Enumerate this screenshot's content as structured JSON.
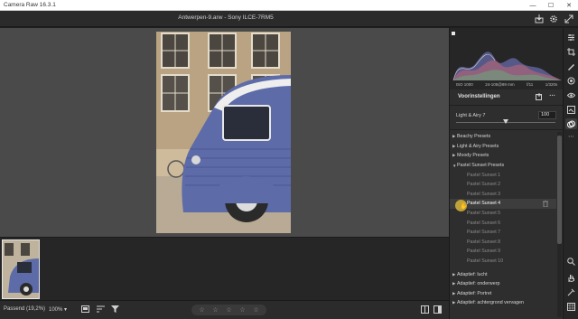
{
  "window": {
    "title": "Camera Raw 16.3.1",
    "minimize": "—",
    "maximize": "☐",
    "close": "✕"
  },
  "header": {
    "filename": "Antwerpen-9.arw  -  Sony ILCE-7RM5",
    "icons": [
      "save-icon",
      "gear-icon",
      "expand-icon"
    ]
  },
  "histogram": {
    "iso": "ISO 1000",
    "lens": "24-105@89 mm",
    "aperture": "f/11",
    "shutter": "1/320s"
  },
  "presets_panel": {
    "title": "Voorinstellingen",
    "amount_label": "Light & Airy 7",
    "amount_value": "100",
    "amount_fraction": 1.0,
    "groups": [
      {
        "label": "Beachy Presets",
        "expanded": false
      },
      {
        "label": "Light & Airy Presets",
        "expanded": false
      },
      {
        "label": "Moody Presets",
        "expanded": false
      },
      {
        "label": "Pastel Sunset Presets",
        "expanded": true
      }
    ],
    "subitems": [
      "Pastel Sunset 1",
      "Pastel Sunset 2",
      "Pastel Sunset 3",
      "Pastel Sunset 4",
      "Pastel Sunset 5",
      "Pastel Sunset 6",
      "Pastel Sunset 7",
      "Pastel Sunset 8",
      "Pastel Sunset 9",
      "Pastel Sunset 10"
    ],
    "active_index": 3,
    "adaptive": [
      "Adaptief: lucht",
      "Adaptief: onderwerp",
      "Adaptief: Portret",
      "Adaptief: achtergrond vervagen"
    ]
  },
  "bottombar": {
    "fit_label": "Passend (19,2%)",
    "zoom_label": "100%",
    "stars": [
      "☆",
      "☆",
      "☆",
      "☆",
      "☆"
    ]
  },
  "colors": {
    "accent_cursor": "#d6b53a",
    "van_blue": "#5d6ba8"
  }
}
